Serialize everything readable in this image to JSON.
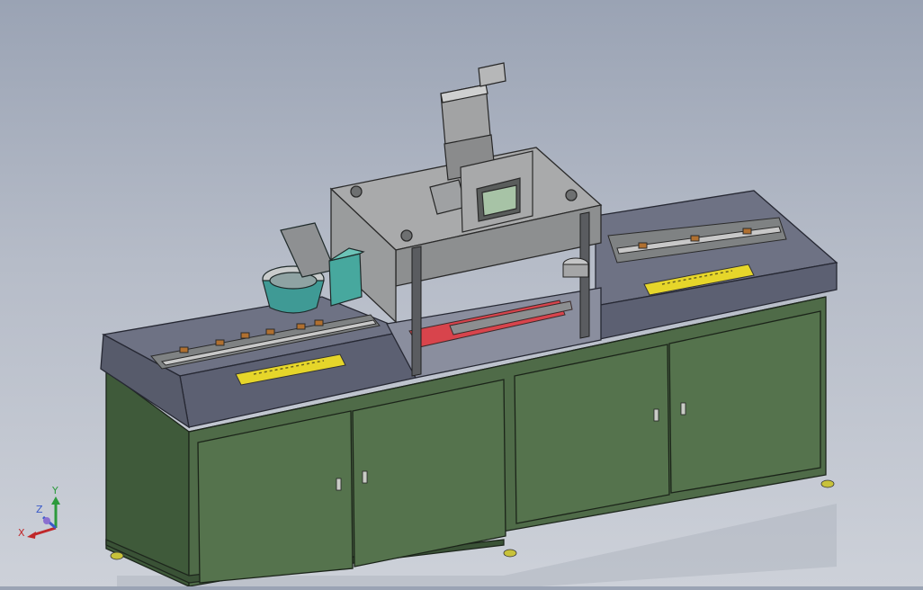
{
  "viewport": {
    "background_top": "#9aa3b4",
    "background_bottom": "#cdd1d9"
  },
  "triad": {
    "x_label": "X",
    "y_label": "Y",
    "z_label": "Z",
    "x_color": "#c0282a",
    "y_color": "#2c9a3c",
    "z_color": "#3a5ac8"
  },
  "colors": {
    "cabinet": "#4f6b48",
    "table_top": "#6e7284",
    "steel": "#9b9d9e",
    "warning_plate": "#e6d62a",
    "conveyor_red": "#d8444c",
    "bowl_teal": "#3f9a95"
  }
}
